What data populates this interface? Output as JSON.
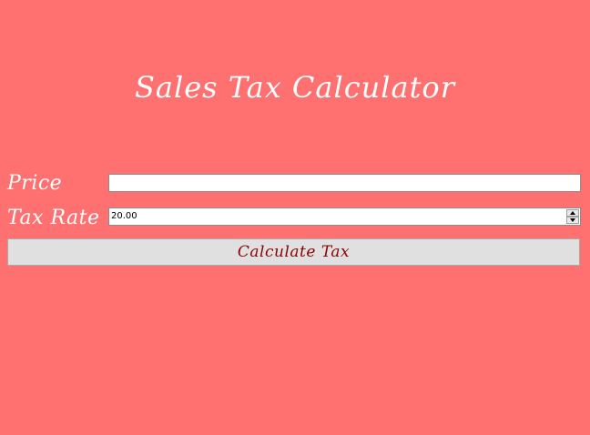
{
  "app": {
    "title": "Sales Tax Calculator"
  },
  "form": {
    "price_label": "Price",
    "price_value": "",
    "tax_rate_label": "Tax Rate",
    "tax_rate_value": "20.00",
    "calculate_label": "Calculate Tax"
  },
  "icons": {
    "spin_up": "spin-up-arrow-icon",
    "spin_down": "spin-down-arrow-icon"
  },
  "colors": {
    "background": "#ff7070",
    "title_text": "#ffffff",
    "button_text": "#8b0000",
    "button_background": "#e0e0e0"
  }
}
